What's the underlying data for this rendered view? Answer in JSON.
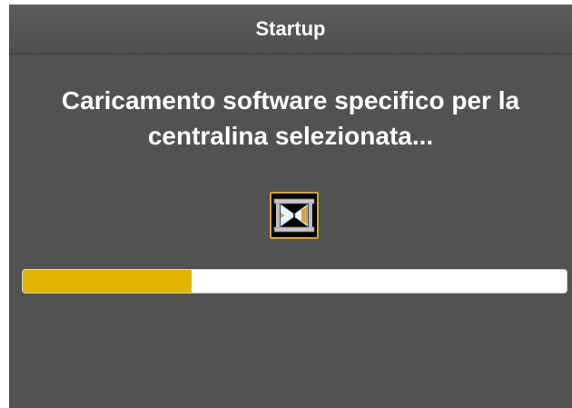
{
  "window": {
    "title": "Startup"
  },
  "message": "Caricamento software specifico per la centralina selezionata...",
  "icon": {
    "name": "hourglass-icon"
  },
  "progress": {
    "value": 0.31,
    "fill_color": "#e0b400",
    "track_color": "#ffffff"
  },
  "colors": {
    "background": "#525252",
    "text": "#ffffff",
    "icon_border": "#d4a82a"
  }
}
